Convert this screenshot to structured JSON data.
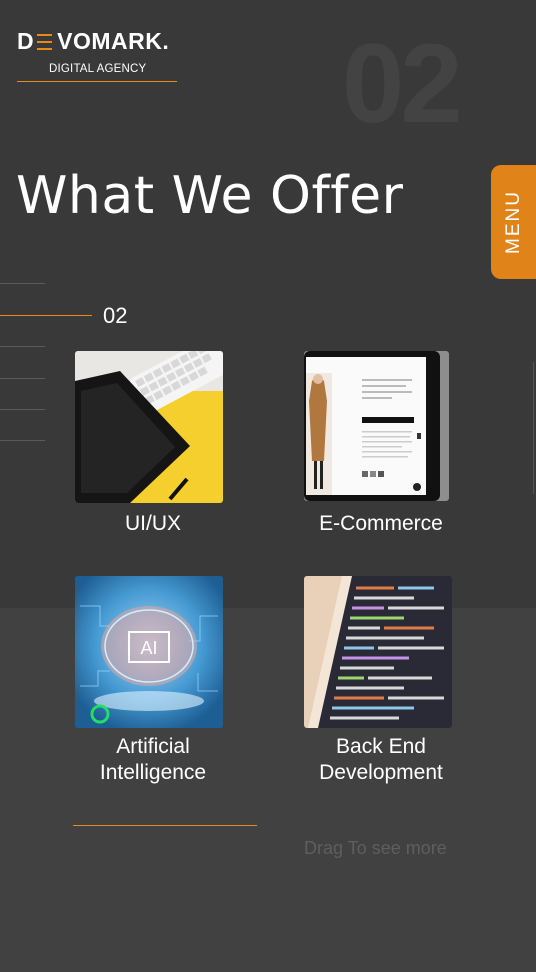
{
  "logo": {
    "name_pre": "D",
    "name_post": "VOMARK.",
    "tagline": "DIGITAL AGENCY"
  },
  "background_number": "02",
  "title": "What We Offer",
  "menu_label": "MENU",
  "counter": "02",
  "services": [
    {
      "label": "UI/UX",
      "image": "keyboard-tablet-image"
    },
    {
      "label": "E-Commerce",
      "image": "ecommerce-tablet-image"
    },
    {
      "label_line1": "Artificial",
      "label_line2": "Intelligence",
      "image": "ai-brain-image"
    },
    {
      "label_line1": "Back End",
      "label_line2": "Development",
      "image": "code-screen-image"
    }
  ],
  "drag_hint": "Drag To see more",
  "colors": {
    "accent": "#e8891a",
    "background": "#3a3a3a"
  }
}
